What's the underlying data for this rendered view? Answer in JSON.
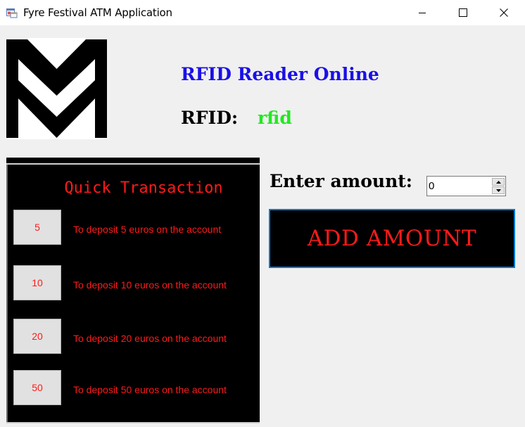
{
  "window": {
    "title": "Fyre Festival ATM Application",
    "controls": [
      "minimize-icon",
      "maximize-icon",
      "close-icon"
    ]
  },
  "status": {
    "heading": "RFID Reader Online",
    "heading_color": "#1a10e8",
    "rfid_label": "RFID:",
    "rfid_value": "rfid",
    "rfid_value_color": "#22e822"
  },
  "quick_transaction": {
    "title": "Quick Transaction",
    "items": [
      {
        "amount": "5",
        "description": "To deposit 5 euros on the account"
      },
      {
        "amount": "10",
        "description": "To deposit 10 euros on the account"
      },
      {
        "amount": "20",
        "description": "To deposit 20 euros on the account"
      },
      {
        "amount": "50",
        "description": "To deposit 50 euros on the account"
      }
    ],
    "text_color": "#ff1a1a"
  },
  "amount": {
    "label": "Enter amount:",
    "value": "0"
  },
  "add_button": {
    "label": "ADD AMOUNT",
    "border_color": "#0078d7"
  }
}
